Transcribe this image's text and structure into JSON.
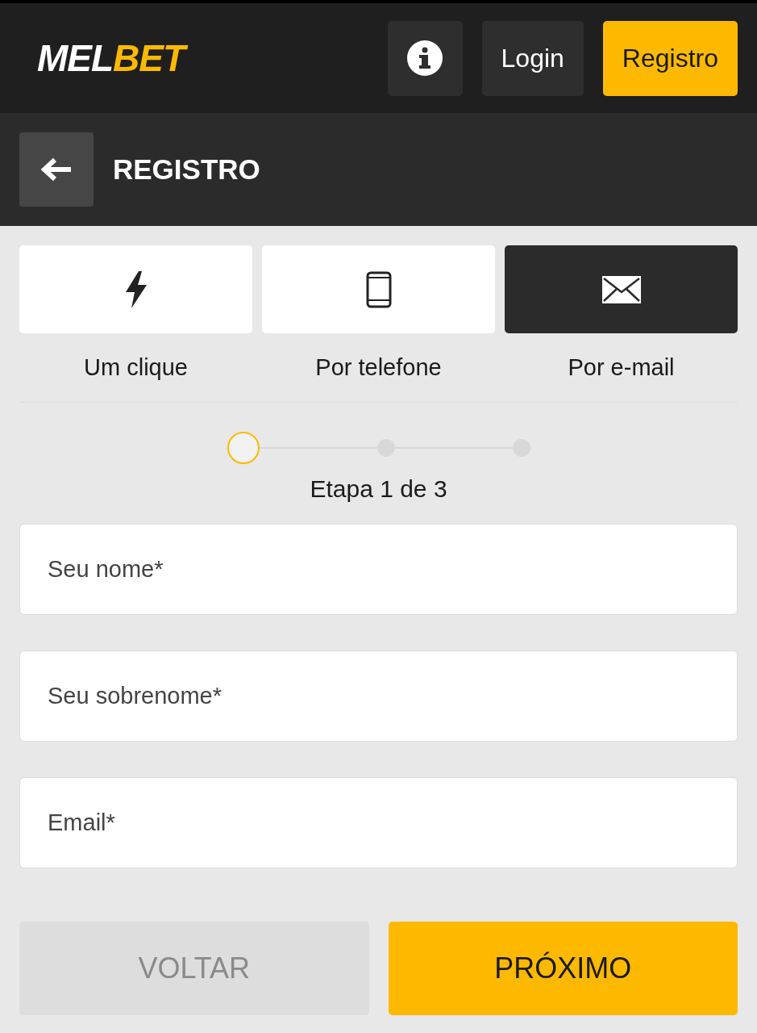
{
  "header": {
    "logo": {
      "first": "MEL",
      "second": "BET"
    },
    "buttons": [
      {
        "label": "Login",
        "kind": "plain"
      },
      {
        "label": "Registro",
        "kind": "primary"
      }
    ]
  },
  "subheader": {
    "title": "REGISTRO"
  },
  "tabs": [
    {
      "kind": "bolt",
      "label": "Um clique",
      "selected": false
    },
    {
      "kind": "phone",
      "label": "Por telefone",
      "selected": false
    },
    {
      "kind": "mail",
      "label": "Por e-mail",
      "selected": true
    }
  ],
  "stepper": {
    "steps": [
      {
        "selected": true
      },
      {
        "selected": false
      },
      {
        "selected": false
      }
    ],
    "caption": "Etapa 1 de 3"
  },
  "fields": [
    {
      "placeholder": "Seu nome*"
    },
    {
      "placeholder": "Seu sobrenome*"
    },
    {
      "placeholder": "Email*"
    }
  ],
  "actions": [
    {
      "label": "VOLTAR",
      "disabled": true,
      "kind": "secondary"
    },
    {
      "label": "PRÓXIMO",
      "disabled": false,
      "kind": "primary"
    }
  ]
}
